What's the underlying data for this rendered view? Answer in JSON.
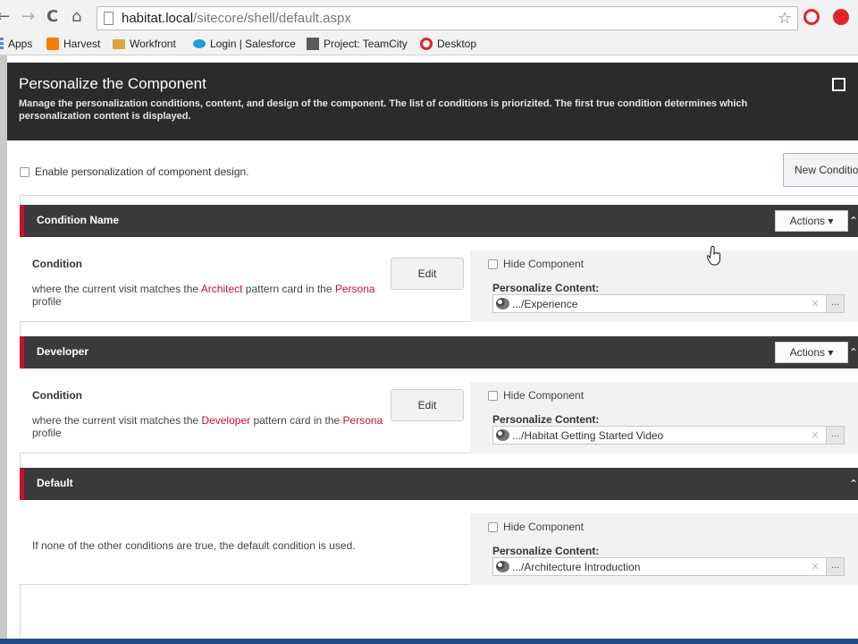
{
  "browser": {
    "back": "←",
    "forward": "→",
    "reload": "C",
    "home": "⌂",
    "url_host": "habitat.local",
    "url_path": "/sitecore/shell/default.aspx",
    "star": "☆",
    "bookmarks": [
      "Apps",
      "Harvest",
      "Workfront",
      "Login | Salesforce",
      "Project: TeamCity",
      "Desktop"
    ],
    "bookmark_colors": [
      "#4a90d9",
      "#f57c00",
      "#d9a441",
      "#1a9fd9",
      "#5a5a5a",
      "#e2252b"
    ]
  },
  "dialog": {
    "title": "Personalize the Component",
    "description": "Manage the personalization conditions, content, and design of the component. The list of conditions is priorizited. The first true condition determines which personalization content is displayed.",
    "enable_label": "Enable personalization of component design.",
    "new_condition_label": "New Condition",
    "accent_color": "#c8102e"
  },
  "sections": [
    {
      "name": "Condition Name",
      "actions": "Actions ▾",
      "condition_label": "Condition",
      "text_before": "where the current visit matches the ",
      "keyword1": "Architect",
      "text_middle": " pattern card in the ",
      "keyword2": "Persona",
      "text_after": " profile",
      "edit": "Edit",
      "hide_label": "Hide Component",
      "pc_label": "Personalize Content:",
      "pc_value": ".../Experience"
    },
    {
      "name": "Developer",
      "actions": "Actions ▾",
      "condition_label": "Condition",
      "text_before": "where the current visit matches the ",
      "keyword1": "Developer",
      "text_middle": " pattern card in the ",
      "keyword2": "Persona",
      "text_after": " profile",
      "edit": "Edit",
      "hide_label": "Hide Component",
      "pc_label": "Personalize Content:",
      "pc_value": ".../Habitat Getting Started Video"
    },
    {
      "name": "Default",
      "default_text": "If none of the other conditions are true, the default condition is used.",
      "hide_label": "Hide Component",
      "pc_label": "Personalize Content:",
      "pc_value": ".../Architecture Introduction"
    }
  ],
  "field_clear": "×",
  "field_browse": "...",
  "collapse_glyph": "⌃"
}
